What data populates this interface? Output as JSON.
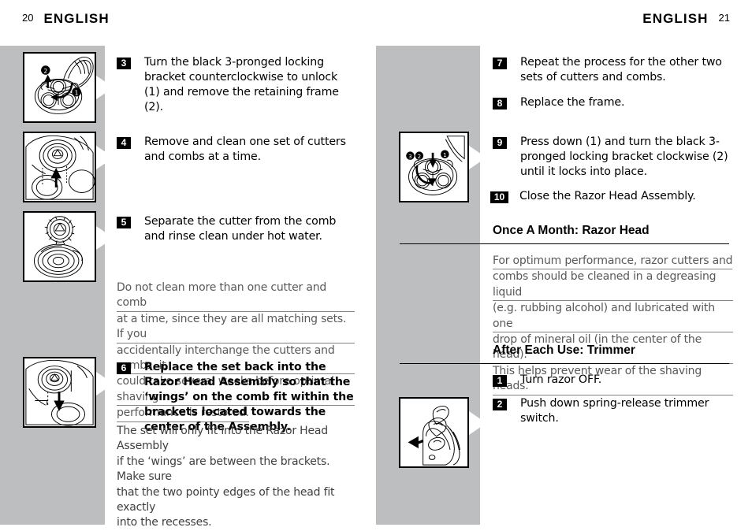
{
  "header": {
    "left_folio": "20",
    "left_title": "ENGLISH",
    "right_title": "ENGLISH",
    "right_folio": "21"
  },
  "left_column": {
    "steps": [
      {
        "number": "3",
        "text": "Turn the black 3-pronged locking bracket counterclockwise to unlock (1) and remove the retaining frame (2)."
      },
      {
        "number": "4",
        "text": "Remove and clean one set of cutters and combs at a time."
      },
      {
        "number": "5",
        "text": "Separate the cutter from the comb and rinse clean under hot water."
      },
      {
        "number": "6",
        "text": "Replace the set back into the Razor Head Assembly so that the ‘wings’ on the comb fit within the brackets located towards the center of the Assembly."
      }
    ],
    "note_lines": [
      "Do not clean more than one cutter and comb",
      "at a time, since they are all matching sets. If you",
      "accidentally interchange the cutters and combs, it",
      "could take several weeks before optimal shaving",
      "performance is restored."
    ],
    "paragraph_lines": [
      "The set will only fit into the Razor Head Assembly",
      "if the ‘wings’ are between the brackets. Make sure",
      "that the two pointy edges of the head fit exactly",
      "into the recesses."
    ]
  },
  "right_column": {
    "steps_top": [
      {
        "number": "7",
        "text": "Repeat the process for the other two sets of cutters and combs."
      },
      {
        "number": "8",
        "text": "Replace the frame."
      },
      {
        "number": "9",
        "text": "Press down (1) and turn the black 3-pronged locking bracket clockwise (2) until it locks into place."
      },
      {
        "number": "10",
        "text": "Close the Razor Head Assembly."
      }
    ],
    "section_month": {
      "title": "Once A Month: Razor Head",
      "note_lines": [
        "For optimum performance, razor cutters and",
        "combs should be cleaned in a degreasing liquid",
        "(e.g. rubbing alcohol) and lubricated with one",
        "drop of mineral oil (in the center of the head).",
        "This helps prevent wear of the shaving heads."
      ]
    },
    "section_trimmer": {
      "title": "After Each Use: Trimmer",
      "steps": [
        {
          "number": "1",
          "text": "Turn razor OFF."
        },
        {
          "number": "2",
          "text": "Push down spring-release trimmer switch."
        }
      ]
    }
  },
  "figures": [
    {
      "name": "razor-head-unlock-bracket",
      "caption_step": "3"
    },
    {
      "name": "remove-cutter-comb-set",
      "caption_step": "4"
    },
    {
      "name": "cutter-separated-from-comb",
      "caption_step": "5"
    },
    {
      "name": "replace-set-into-head",
      "caption_step": "6"
    },
    {
      "name": "lock-bracket-clockwise",
      "caption_step": "9"
    },
    {
      "name": "trimmer-spring-release",
      "caption_step": "2"
    }
  ],
  "colors": {
    "rail_gray": "#bcbec0",
    "badge_black": "#000000",
    "note_gray": "#58595b",
    "page_white": "#ffffff"
  }
}
